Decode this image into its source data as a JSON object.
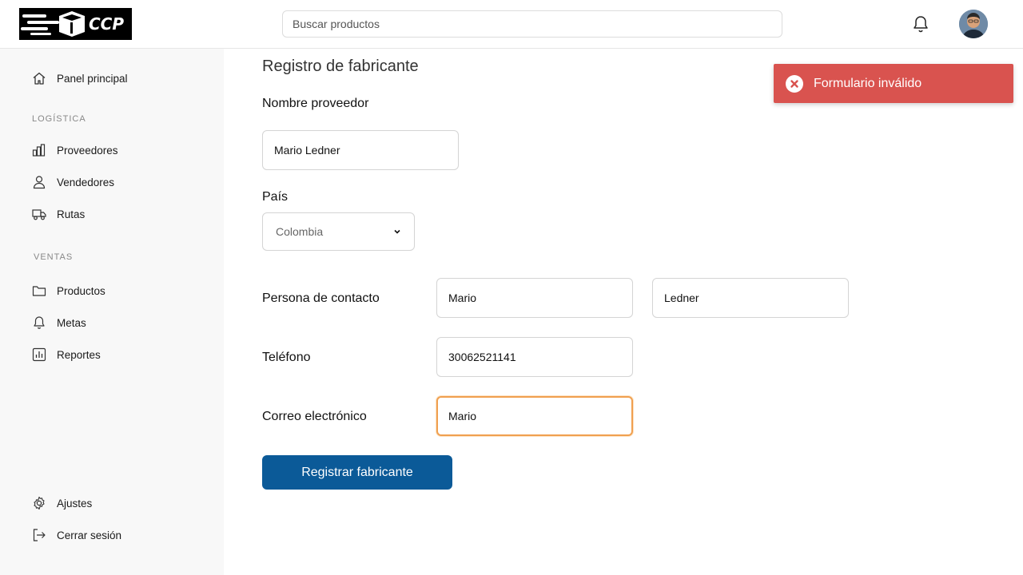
{
  "header": {
    "logo_text": "CCP",
    "search_placeholder": "Buscar productos"
  },
  "sidebar": {
    "home": "Panel principal",
    "section_logistics": "LOGÍSTICA",
    "logistics_items": [
      "Proveedores",
      "Vendedores",
      "Rutas"
    ],
    "section_sales": "VENTAS",
    "sales_items": [
      "Productos",
      "Metas",
      "Reportes"
    ],
    "settings": "Ajustes",
    "logout": "Cerrar sesión"
  },
  "form": {
    "title": "Registro de fabricante",
    "supplier_label": "Nombre proveedor",
    "supplier_value": "Mario Ledner",
    "country_label": "País",
    "country_value": "Colombia",
    "contact_label": "Persona de contacto",
    "contact_first": "Mario",
    "contact_last": "Ledner",
    "phone_label": "Teléfono",
    "phone_value": "30062521141",
    "email_label": "Correo electrónico",
    "email_value": "Mario",
    "submit_label": "Registrar fabricante"
  },
  "toast": {
    "message": "Formulario inválido",
    "color": "#d9534f"
  },
  "colors": {
    "primary": "#0b5a98",
    "focus": "#f0a050"
  }
}
